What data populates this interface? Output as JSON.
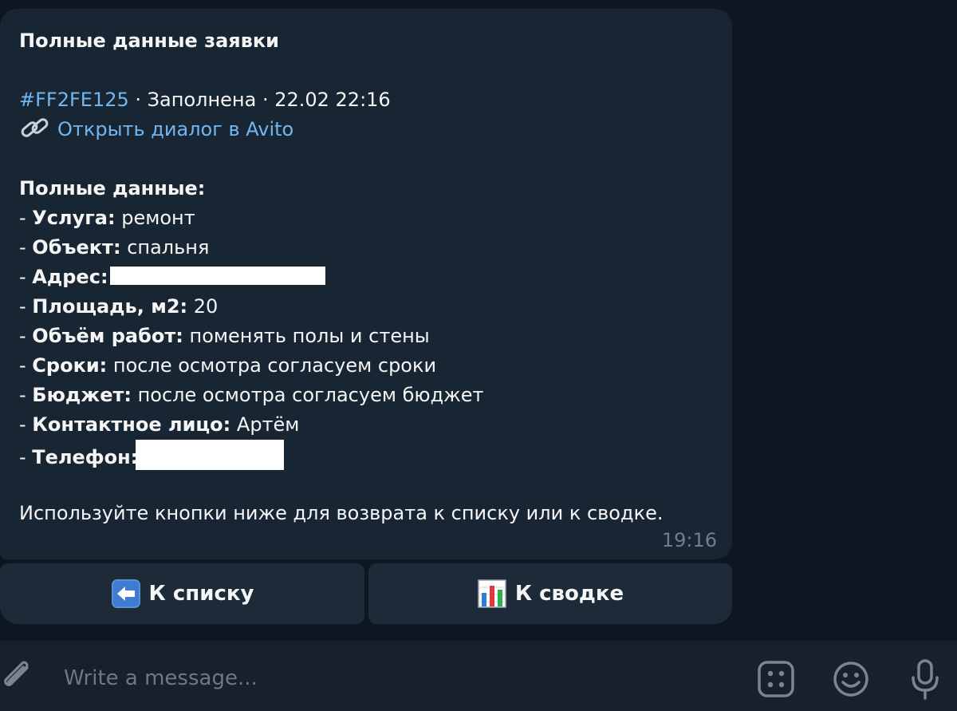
{
  "message": {
    "title": "Полные данные заявки",
    "request_id": "#FF2FE125",
    "status_line": " · Заполнена · 22.02 22:16",
    "link_text": "Открыть диалог в Avito",
    "section_title": "Полные данные:",
    "fields": [
      {
        "prefix": "- ",
        "label": "Услуга:",
        "value": " ремонт"
      },
      {
        "prefix": "- ",
        "label": "Объект:",
        "value": " спальня"
      },
      {
        "prefix": "- ",
        "label": "Адрес:",
        "value": ""
      },
      {
        "prefix": "- ",
        "label": "Площадь, м2:",
        "value": " 20"
      },
      {
        "prefix": "- ",
        "label": "Объём работ:",
        "value": " поменять полы и стены"
      },
      {
        "prefix": "- ",
        "label": "Сроки:",
        "value": " после осмотра согласуем сроки"
      },
      {
        "prefix": "- ",
        "label": "Бюджет:",
        "value": " после осмотра согласуем бюджет"
      },
      {
        "prefix": "- ",
        "label": "Контактное лицо:",
        "value": " Артём"
      },
      {
        "prefix": "- ",
        "label": "Телефон:",
        "value": ""
      }
    ],
    "hint": "Используйте кнопки ниже для возврата к списку или к сводке.",
    "time": "19:16"
  },
  "keyboard": {
    "back_label": "К списку",
    "summary_label": "К сводке"
  },
  "composer": {
    "placeholder": "Write a message..."
  },
  "colors": {
    "link": "#71b6ee",
    "bubble": "#182533",
    "background": "#0e1621"
  },
  "icons": {
    "link": "link-icon",
    "back": "back-arrow-icon",
    "summary": "bar-chart-icon",
    "attach": "paperclip-icon",
    "commands": "bot-commands-icon",
    "emoji": "emoji-icon",
    "voice": "microphone-icon"
  }
}
